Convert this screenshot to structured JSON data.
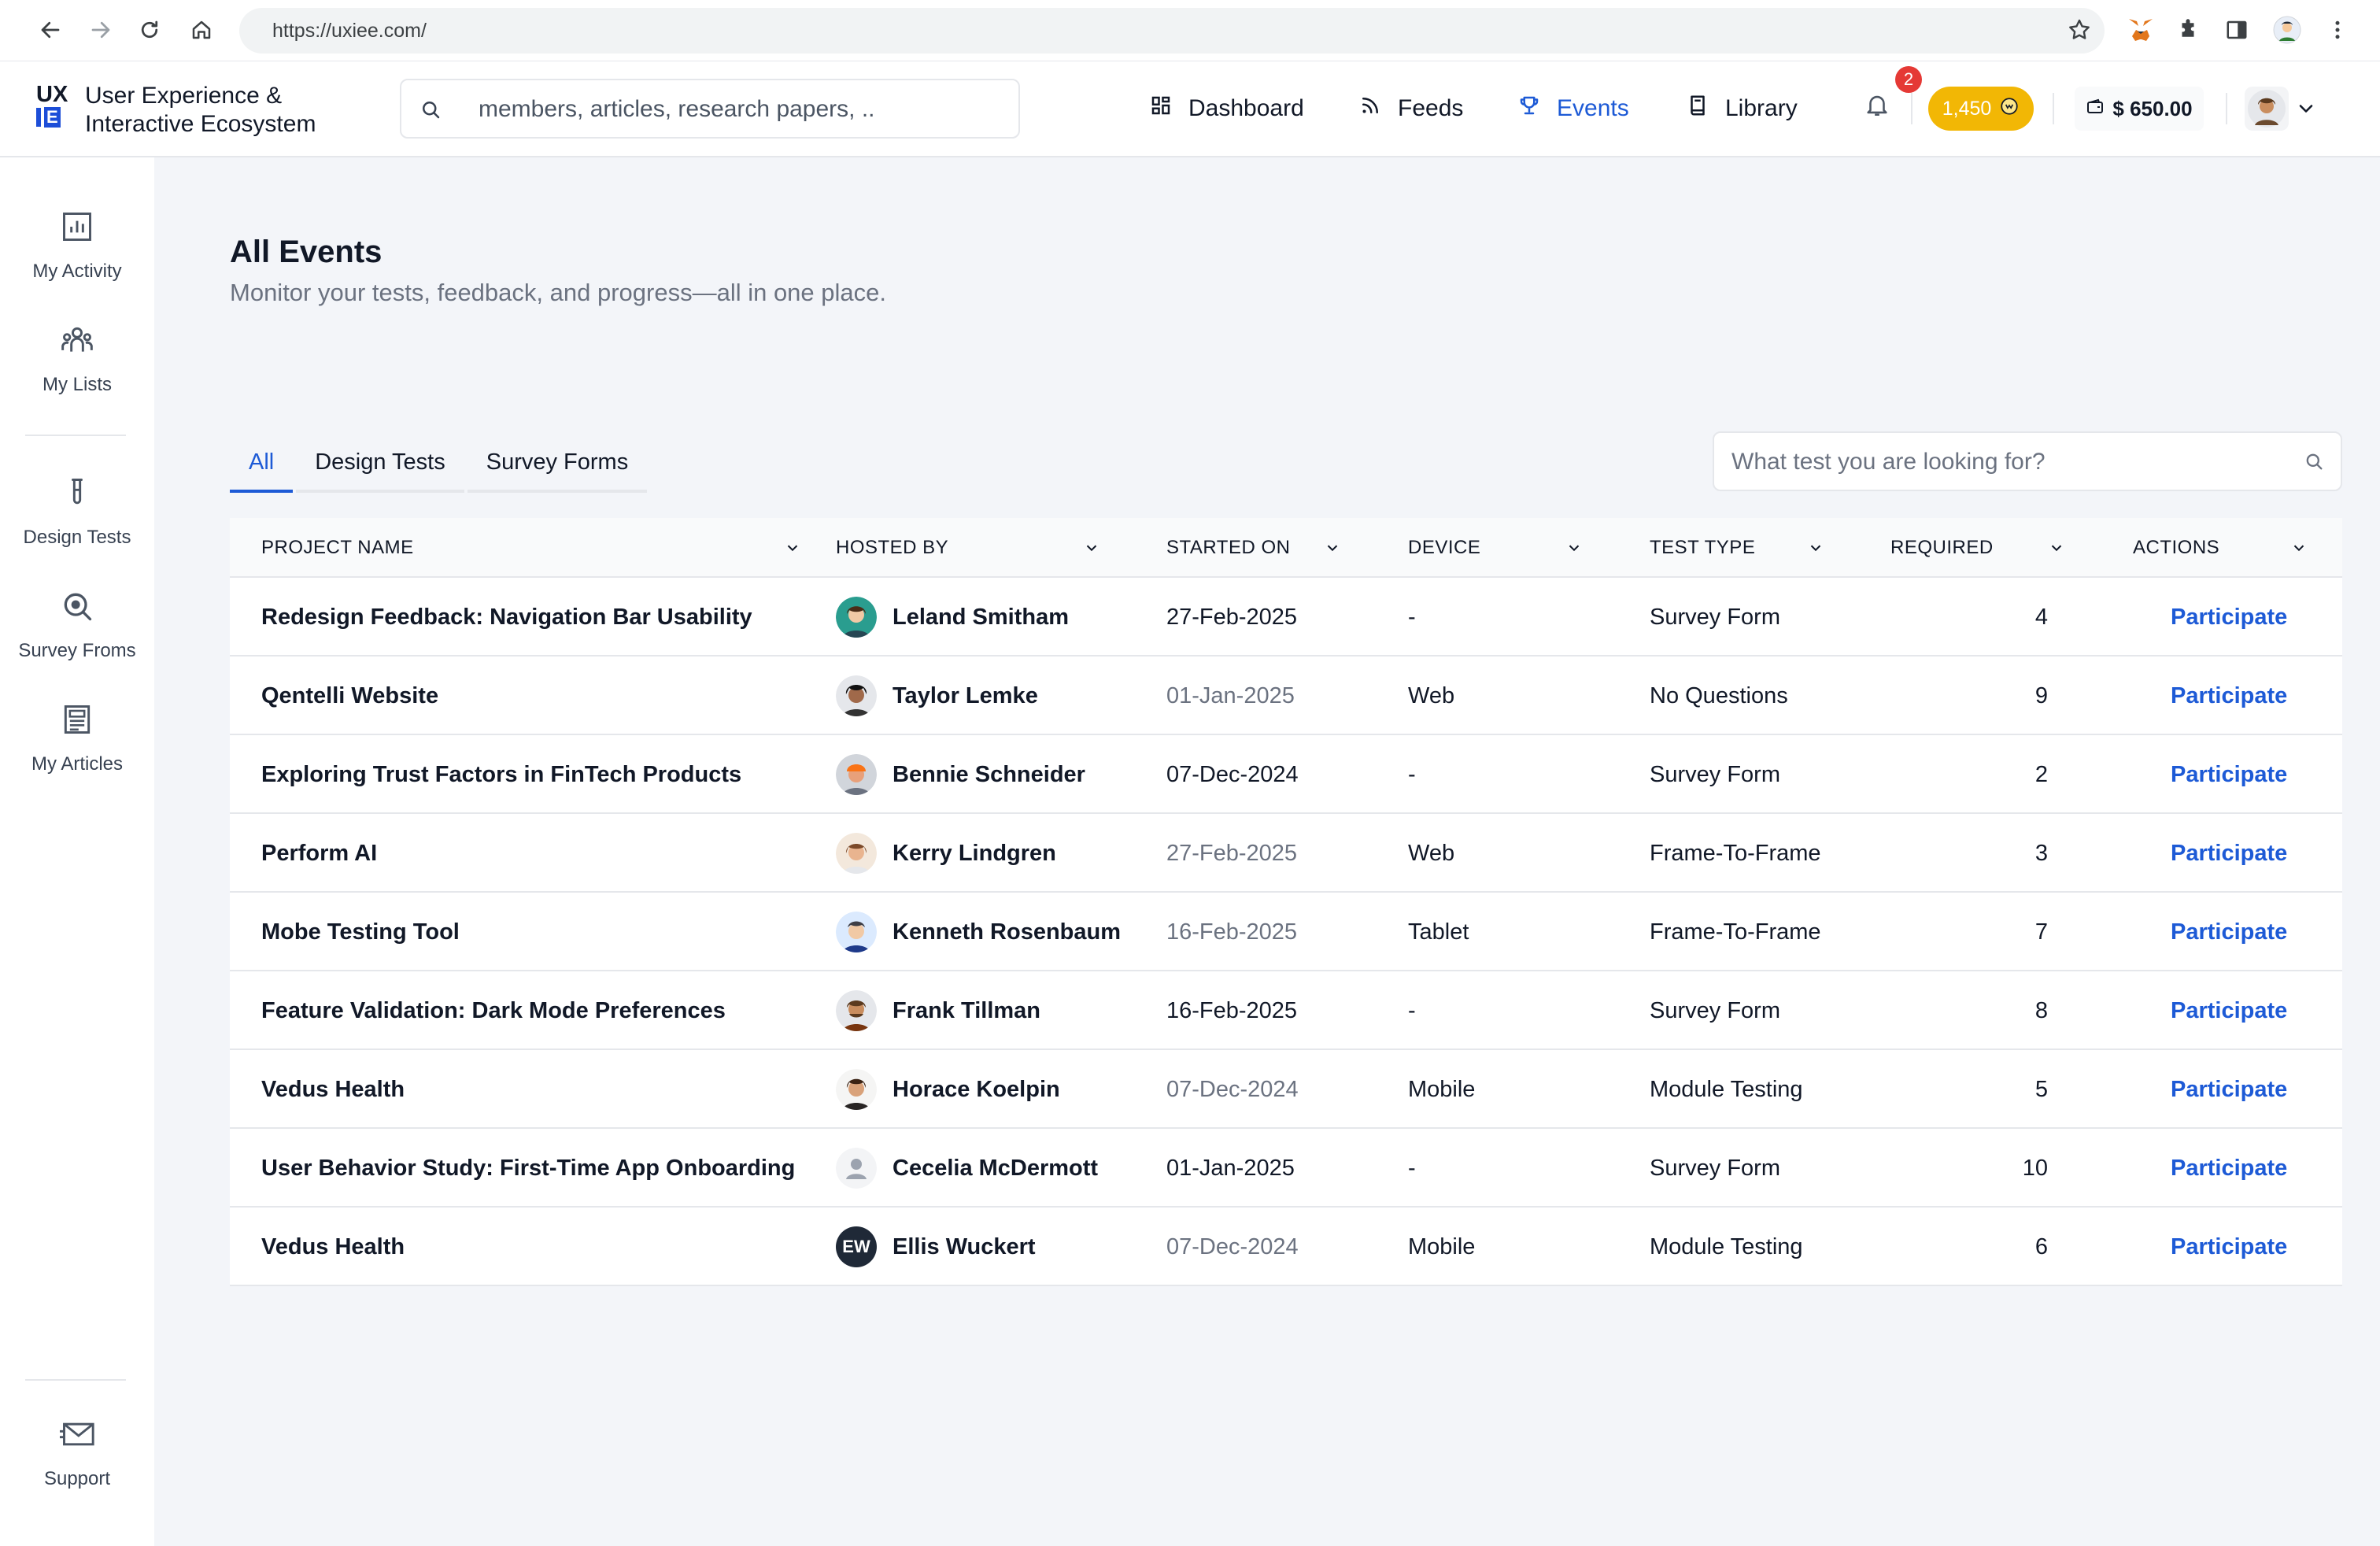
{
  "browser": {
    "url": "https://uxiee.com/"
  },
  "header": {
    "logo_line1": "UX",
    "logo_line2": "IE",
    "brand_line1": "User Experience &",
    "brand_line2": "Interactive Ecosystem",
    "search_placeholder": "members, articles, research papers, ..",
    "nav": [
      {
        "label": "Dashboard",
        "icon": "dashboard-grid-icon"
      },
      {
        "label": "Feeds",
        "icon": "rss-icon"
      },
      {
        "label": "Events",
        "icon": "trophy-icon",
        "active": true
      },
      {
        "label": "Library",
        "icon": "book-icon"
      }
    ],
    "notifications_count": "2",
    "points": "1,450",
    "wallet": "$ 650.00"
  },
  "sidebar": {
    "items": [
      {
        "label": "My Activity",
        "icon": "bar-chart-icon"
      },
      {
        "label": "My Lists",
        "icon": "people-icon"
      },
      {
        "label": "Design Tests",
        "icon": "test-tube-icon"
      },
      {
        "label": "Survey Froms",
        "icon": "magnifier-icon"
      },
      {
        "label": "My Articles",
        "icon": "article-icon"
      },
      {
        "label": "Support",
        "icon": "mail-icon"
      }
    ]
  },
  "page": {
    "title": "All Events",
    "subtitle": "Monitor your tests, feedback, and progress—all in one place.",
    "tabs": [
      "All",
      "Design Tests",
      "Survey Forms"
    ],
    "test_search_placeholder": "What test you are looking for?"
  },
  "table": {
    "columns": [
      "PROJECT NAME",
      "HOSTED BY",
      "STARTED ON",
      "DEVICE",
      "TEST TYPE",
      "REQUIRED",
      "ACTIONS"
    ],
    "rows": [
      {
        "project": "Redesign Feedback: Navigation Bar Usability",
        "host": "Leland Smitham",
        "started": "27-Feb-2025",
        "started_muted": false,
        "device": "-",
        "type": "Survey Form",
        "required": "4",
        "action": "Participate"
      },
      {
        "project": "Qentelli Website",
        "host": "Taylor Lemke",
        "started": "01-Jan-2025",
        "started_muted": true,
        "device": "Web",
        "type": "No Questions",
        "required": "9",
        "action": "Participate"
      },
      {
        "project": "Exploring Trust Factors in FinTech Products",
        "host": "Bennie Schneider",
        "started": "07-Dec-2024",
        "started_muted": false,
        "device": "-",
        "type": "Survey Form",
        "required": "2",
        "action": "Participate"
      },
      {
        "project": "Perform AI",
        "host": "Kerry Lindgren",
        "started": "27-Feb-2025",
        "started_muted": true,
        "device": "Web",
        "type": "Frame-To-Frame",
        "required": "3",
        "action": "Participate"
      },
      {
        "project": "Mobe Testing Tool",
        "host": "Kenneth Rosenbaum",
        "started": "16-Feb-2025",
        "started_muted": true,
        "device": "Tablet",
        "type": "Frame-To-Frame",
        "required": "7",
        "action": "Participate"
      },
      {
        "project": "Feature Validation: Dark Mode Preferences",
        "host": "Frank Tillman",
        "started": "16-Feb-2025",
        "started_muted": false,
        "device": "-",
        "type": "Survey Form",
        "required": "8",
        "action": "Participate"
      },
      {
        "project": "Vedus Health",
        "host": "Horace Koelpin",
        "started": "07-Dec-2024",
        "started_muted": true,
        "device": "Mobile",
        "type": "Module Testing",
        "required": "5",
        "action": "Participate"
      },
      {
        "project": "User Behavior Study: First-Time App Onboarding",
        "host": "Cecelia McDermott",
        "started": "01-Jan-2025",
        "started_muted": false,
        "device": "-",
        "type": "Survey Form",
        "required": "10",
        "action": "Participate"
      },
      {
        "project": "Vedus Health",
        "host": "Ellis Wuckert",
        "host_initials": "EW",
        "started": "07-Dec-2024",
        "started_muted": true,
        "device": "Mobile",
        "type": "Module Testing",
        "required": "6",
        "action": "Participate"
      }
    ]
  },
  "colors": {
    "accent": "#1d5ad6",
    "points_badge": "#f2b705",
    "notification_badge": "#e53935",
    "main_bg": "#f3f5f9"
  }
}
